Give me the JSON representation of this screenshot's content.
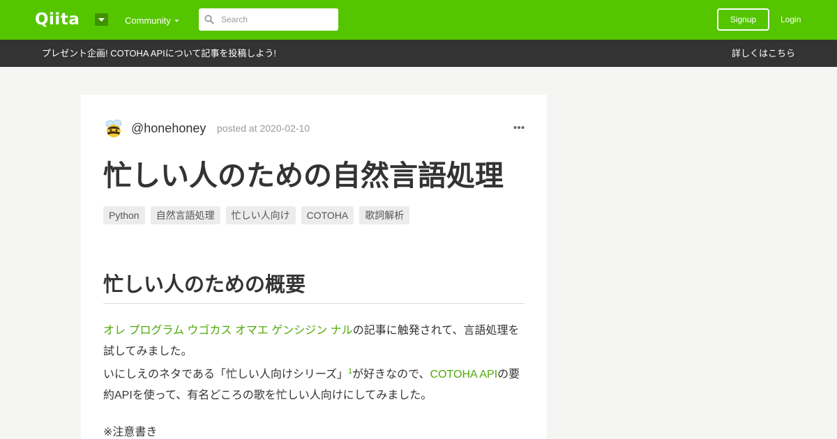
{
  "header": {
    "logo": "Qiita",
    "community_label": "Community",
    "search_placeholder": "Search",
    "signup_label": "Signup",
    "login_label": "Login"
  },
  "banner": {
    "text": "プレゼント企画! COTOHA APIについて記事を投稿しよう!",
    "link": "詳しくはこちら"
  },
  "article": {
    "author": "@honehoney",
    "posted": "posted at 2020-02-10",
    "title": "忙しい人のための自然言語処理",
    "tags": [
      "Python",
      "自然言語処理",
      "忙しい人向け",
      "COTOHA",
      "歌詞解析"
    ],
    "section_heading": "忙しい人のための概要",
    "p1_link": "オレ プログラム ウゴカス オマエ ゲンシジン ナル",
    "p1_text": "の記事に触発されて、言語処理を試してみました。",
    "p2_text_a": "いにしえのネタである「忙しい人向けシリーズ」",
    "p2_footnote": "1",
    "p2_text_b": "が好きなので、",
    "p2_link": "COTOHA API",
    "p2_text_c": "の要約APIを使って、有名どころの歌を忙しい人向けにしてみました。",
    "p3_text": "※注意書き"
  },
  "colors": {
    "brand_green": "#55c500",
    "banner_bg": "#333333",
    "link_green": "#4eaa08",
    "page_bg": "#f5f5f3"
  },
  "icons": [
    "menu-caret-icon",
    "caret-down-icon",
    "search-icon",
    "bee-avatar-icon",
    "more-options-icon"
  ]
}
